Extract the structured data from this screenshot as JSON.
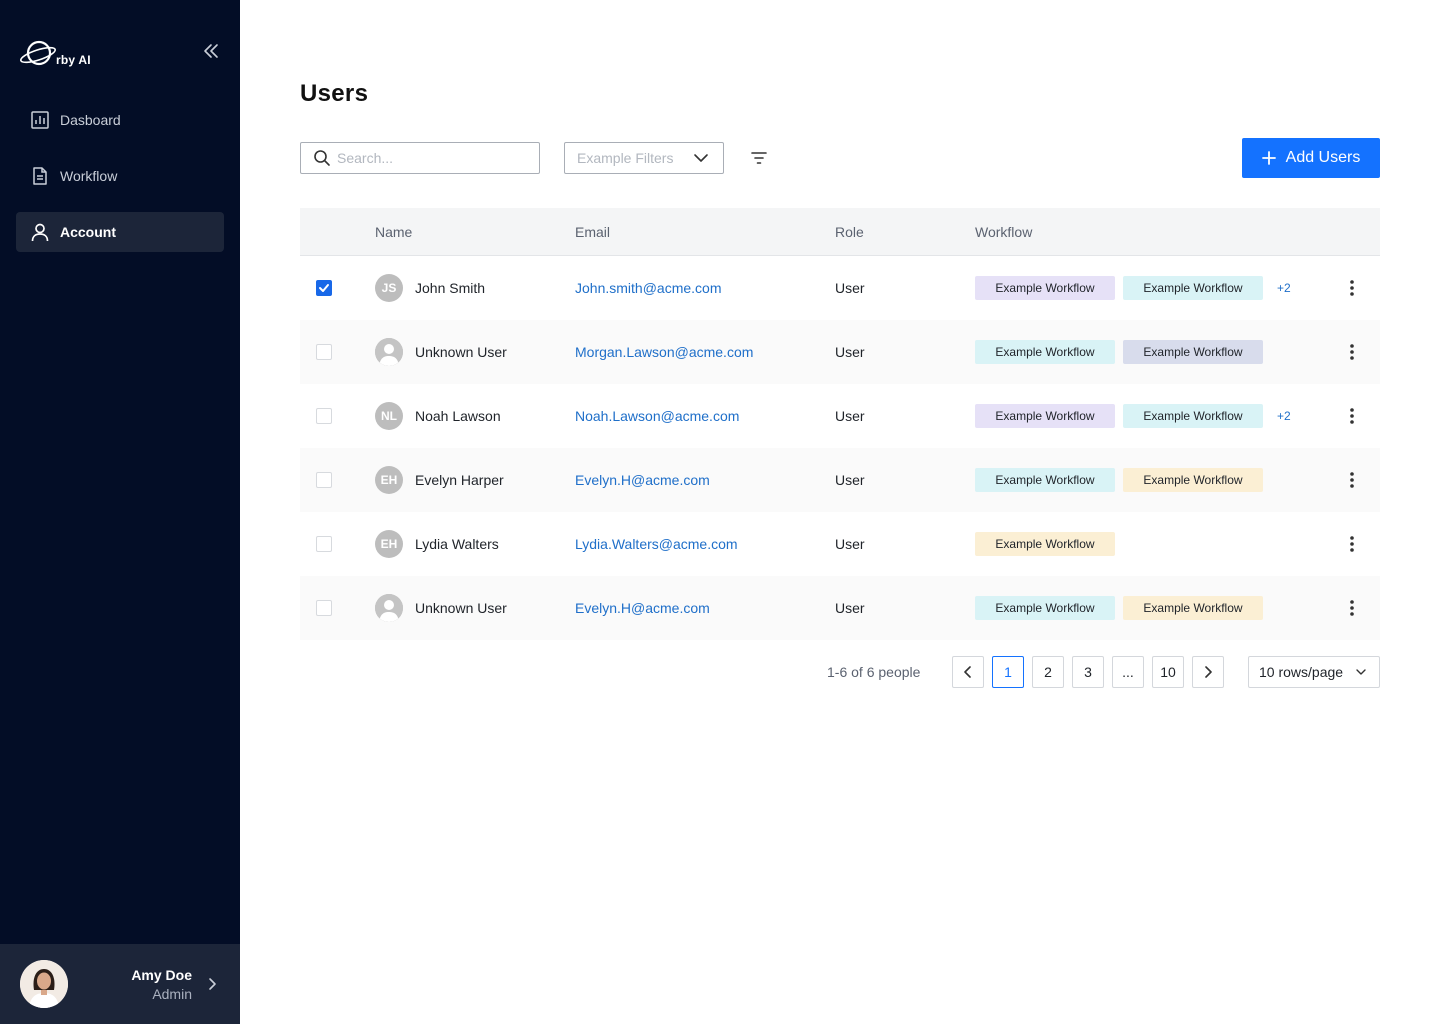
{
  "app": {
    "logo_text": "rby AI"
  },
  "sidebar": {
    "items": [
      {
        "label": "Dasboard",
        "icon": "bar-chart-icon"
      },
      {
        "label": "Workflow",
        "icon": "document-icon"
      },
      {
        "label": "Account",
        "icon": "user-icon",
        "active": true
      }
    ],
    "user": {
      "name": "Amy Doe",
      "role": "Admin"
    }
  },
  "page": {
    "title": "Users"
  },
  "toolbar": {
    "search_placeholder": "Search...",
    "filter_placeholder": "Example Filters",
    "add_label": "Add Users"
  },
  "table": {
    "headers": {
      "name": "Name",
      "email": "Email",
      "role": "Role",
      "workflow": "Workflow"
    },
    "rows": [
      {
        "checked": true,
        "initials": "JS",
        "name": "John Smith",
        "email": "John.smith@acme.com",
        "role": "User",
        "tags": [
          "Example Workflow",
          "Example Workflow"
        ],
        "tag_colors": [
          "purple",
          "cyan"
        ],
        "more": "+2"
      },
      {
        "checked": false,
        "initials": "",
        "name": "Unknown User",
        "email": "Morgan.Lawson@acme.com",
        "role": "User",
        "tags": [
          "Example Workflow",
          "Example Workflow"
        ],
        "tag_colors": [
          "cyan",
          "lav"
        ],
        "more": ""
      },
      {
        "checked": false,
        "initials": "NL",
        "name": "Noah Lawson",
        "email": "Noah.Lawson@acme.com",
        "role": "User",
        "tags": [
          "Example Workflow",
          "Example Workflow"
        ],
        "tag_colors": [
          "purple",
          "cyan"
        ],
        "more": "+2"
      },
      {
        "checked": false,
        "initials": "EH",
        "name": "Evelyn Harper",
        "email": "Evelyn.H@acme.com",
        "role": "User",
        "tags": [
          "Example Workflow",
          "Example Workflow"
        ],
        "tag_colors": [
          "cyan",
          "yellow"
        ],
        "more": ""
      },
      {
        "checked": false,
        "initials": "EH",
        "name": "Lydia Walters",
        "email": "Lydia.Walters@acme.com",
        "role": "User",
        "tags": [
          "Example Workflow"
        ],
        "tag_colors": [
          "yellow"
        ],
        "more": ""
      },
      {
        "checked": false,
        "initials": "",
        "name": "Unknown User",
        "email": "Evelyn.H@acme.com",
        "role": "User",
        "tags": [
          "Example Workflow",
          "Example Workflow"
        ],
        "tag_colors": [
          "cyan",
          "yellow"
        ],
        "more": ""
      }
    ]
  },
  "pagination": {
    "summary": "1-6 of 6 people",
    "pages": [
      "1",
      "2",
      "3",
      "...",
      "10"
    ],
    "current": "1",
    "rows_per_page": "10 rows/page"
  },
  "colors": {
    "sidebar_bg": "#030d26",
    "sidebar_active": "#1c2539",
    "primary": "#1472ff",
    "link": "#1f6fc9",
    "tag_purple": "#e6e1f7",
    "tag_cyan": "#d9f3f6",
    "tag_lavender": "#d8dcec",
    "tag_yellow": "#fbefd4"
  }
}
